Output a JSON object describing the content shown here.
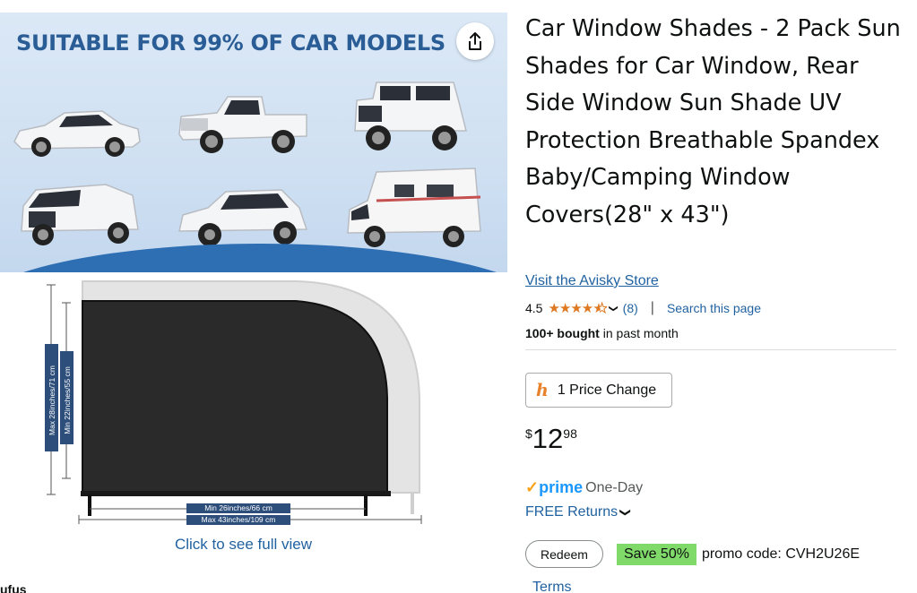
{
  "gallery": {
    "headline": "SUITABLE FOR 99% OF CAR MODELS",
    "share_icon": "share-icon",
    "dimensions": {
      "max_height": "Max 28inches/71 cm",
      "min_height": "Min 22inches/55 cm",
      "min_width": "Min 26inches/66 cm",
      "max_width": "Max 43inches/109 cm"
    },
    "view_link": "Click to see full view",
    "cutoff_text": "ufus"
  },
  "product": {
    "title": "Car Window Shades - 2 Pack Sun Shades for Car Window, Rear Side Window Sun Shade UV Protection Breathable Spandex Baby/Camping Window Covers(28\" x 43\")",
    "store_link": "Visit the Avisky Store",
    "rating": {
      "value": "4.5",
      "stars": 4.5,
      "count": "(8)",
      "separator": "|",
      "search_link": "Search this page"
    },
    "bought": {
      "bold": "100+ bought",
      "rest": " in past month"
    },
    "price_change": {
      "icon": "keepa-icon",
      "label": "1 Price Change"
    },
    "price": {
      "currency": "$",
      "whole": "12",
      "fraction": "98"
    },
    "prime": {
      "check": "✓",
      "word": "prime",
      "delivery": "One-Day"
    },
    "returns": "FREE Returns",
    "promo": {
      "redeem": "Redeem",
      "save": "Save 50%",
      "code_text": "promo code: CVH2U26E"
    },
    "terms": "Terms"
  },
  "colors": {
    "link": "#2162a1",
    "star": "#de7921",
    "prime_blue": "#1a98ff",
    "save_green": "#7fda69",
    "headline_blue": "#2a5d96"
  }
}
